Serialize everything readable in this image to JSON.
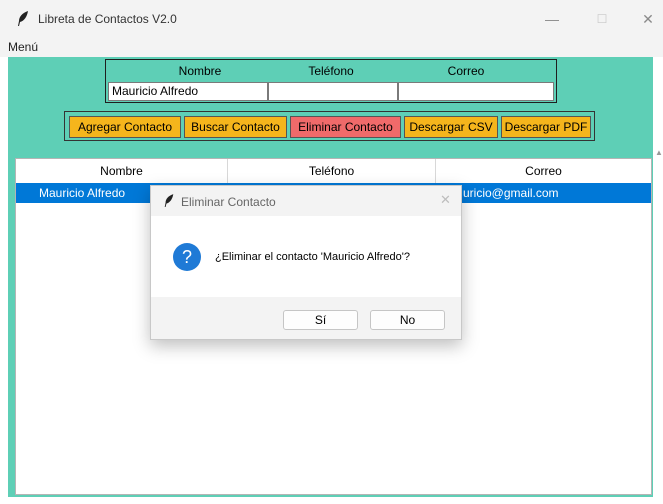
{
  "window": {
    "title": "Libreta de Contactos V2.0",
    "minimize": "—",
    "maximize": "☐",
    "close": "✕"
  },
  "menu": {
    "label": "Menú"
  },
  "form": {
    "headers": [
      "Nombre",
      "Teléfono",
      "Correo"
    ],
    "values": {
      "nombre": "Mauricio Alfredo",
      "telefono": "",
      "correo": ""
    }
  },
  "buttons": {
    "agregar": "Agregar Contacto",
    "buscar": "Buscar Contacto",
    "eliminar": "Eliminar Contacto",
    "csv": "Descargar CSV",
    "pdf": "Descargar PDF"
  },
  "table": {
    "columns": [
      "Nombre",
      "Teléfono",
      "Correo"
    ],
    "rows": [
      {
        "nombre": "Mauricio Alfredo",
        "telefono": "",
        "correo": "mauricio@gmail.com",
        "correo_visible": "uricio@gmail.com",
        "selected": true
      }
    ]
  },
  "dialog": {
    "title": "Eliminar Contacto",
    "message": "¿Eliminar el contacto 'Mauricio Alfredo'?",
    "yes": "Sí",
    "no": "No",
    "close": "✕",
    "icon": "question-icon"
  },
  "colors": {
    "background_green": "#5ecfb6",
    "button_orange": "#f5b51c",
    "button_red": "#f06a6a",
    "selection_blue": "#0078d7",
    "question_blue": "#1f7ad6"
  }
}
